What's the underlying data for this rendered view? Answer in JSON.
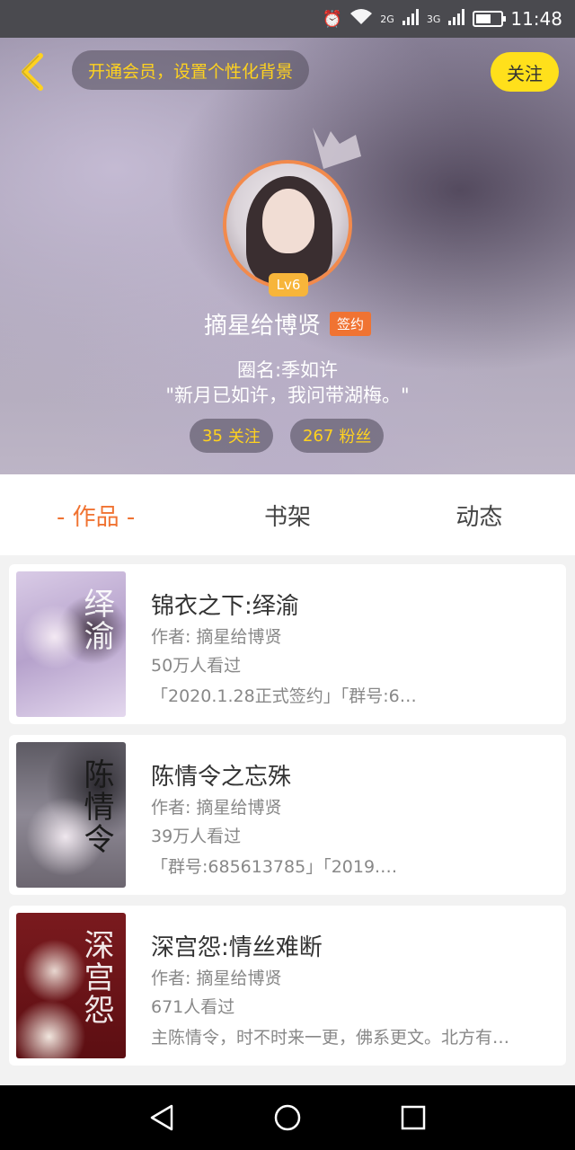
{
  "status_bar": {
    "time": "11:48",
    "network_1": "2G",
    "network_2": "3G",
    "icons": [
      "alarm-icon",
      "wifi-icon",
      "signal-icon",
      "signal-icon",
      "battery-icon"
    ]
  },
  "header": {
    "vip_banner": "开通会员，设置个性化背景",
    "follow_label": "关注",
    "level": "Lv6",
    "username": "摘星给博贤",
    "sign_badge": "签约",
    "circle_name": "圈名:季如许",
    "motto": "\"新月已如许，我问带湖梅。\"",
    "following_count": "35",
    "following_label": "关注",
    "fans_count": "267",
    "fans_label": "粉丝"
  },
  "tabs": [
    {
      "label": "- 作品 -",
      "active": true
    },
    {
      "label": "书架",
      "active": false
    },
    {
      "label": "动态",
      "active": false
    }
  ],
  "books": [
    {
      "title": "锦衣之下:绎渝",
      "author": "作者: 摘星给博贤",
      "views": "50万人看过",
      "desc": "「2020.1.28正式签约」「群号:6…",
      "cover_text": "绎渝"
    },
    {
      "title": "陈情令之忘殊",
      "author": "作者: 摘星给博贤",
      "views": "39万人看过",
      "desc": "「群号:685613785」「2019.…",
      "cover_text": "陈情令"
    },
    {
      "title": "深宫怨:情丝难断",
      "author": "作者: 摘星给博贤",
      "views": "671人看过",
      "desc": "主陈情令，时不时来一更，佛系更文。北方有…",
      "cover_text": "深宫怨"
    }
  ],
  "colors": {
    "accent_orange": "#f07332",
    "vip_yellow": "#ffd21f",
    "follow_button": "#ffe01b",
    "level_badge": "#f7b53a"
  }
}
